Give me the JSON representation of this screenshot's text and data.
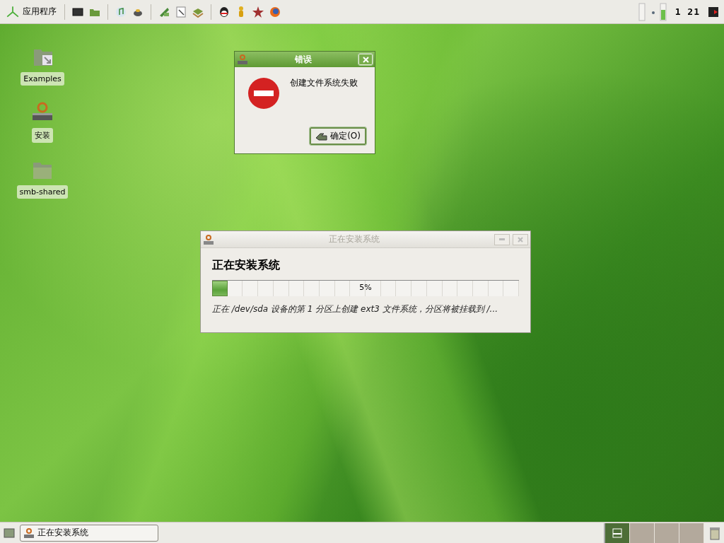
{
  "top_panel": {
    "menu_label": "应用程序",
    "clock": "1 21"
  },
  "desktop_icons": [
    {
      "label": "Examples",
      "kind": "folder-link"
    },
    {
      "label": "安装",
      "kind": "installer"
    },
    {
      "label": "smb-shared",
      "kind": "folder"
    }
  ],
  "error_dialog": {
    "title": "错误",
    "message": "创建文件系统失败",
    "button": "确定(O)"
  },
  "install_window": {
    "title": "正在安装系统",
    "heading": "正在安装系统",
    "progress": {
      "level": 0.05,
      "reading": "5%"
    },
    "status": "正在 /dev/sda 设备的第 1 分区上创建 ext3 文件系统，分区将被挂载到 /..."
  },
  "bottom_panel": {
    "task": "正在安装系统",
    "workspaces": [
      {
        "selected": true
      },
      {
        "selected": false
      },
      {
        "selected": false
      },
      {
        "selected": false
      }
    ]
  }
}
